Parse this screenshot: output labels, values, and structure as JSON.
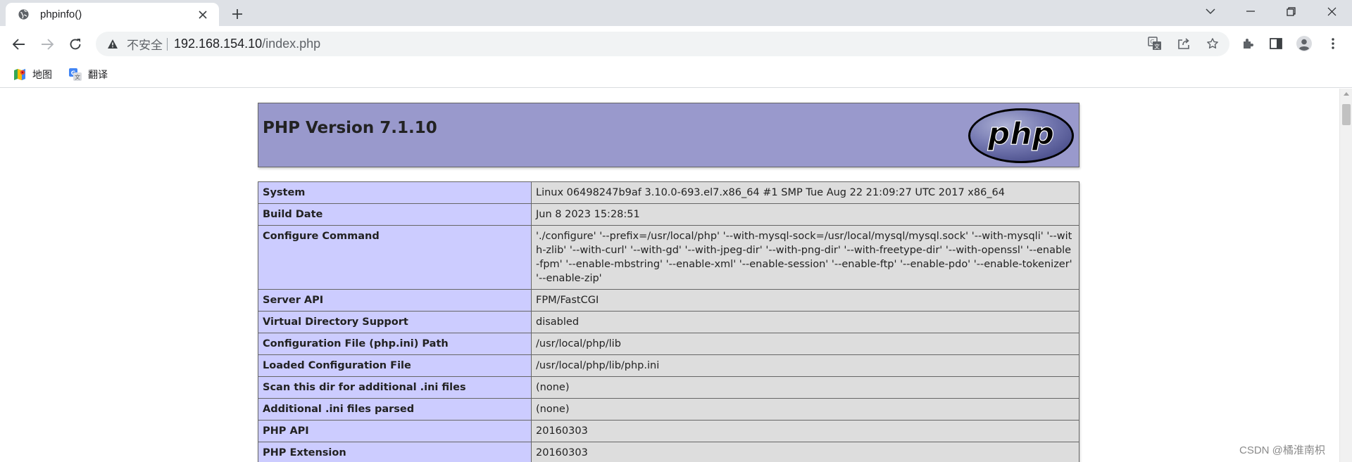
{
  "browser": {
    "tab": {
      "title": "phpinfo()"
    },
    "address": {
      "security_label": "不安全",
      "host": "192.168.154.10",
      "path": "/index.php"
    },
    "bookmarks": [
      {
        "label": "地图",
        "icon": "maps-icon"
      },
      {
        "label": "翻译",
        "icon": "translate-icon"
      }
    ]
  },
  "php": {
    "version_title": "PHP Version 7.1.10",
    "logo_text": "php",
    "rows": [
      {
        "key": "System",
        "value": "Linux 06498247b9af 3.10.0-693.el7.x86_64 #1 SMP Tue Aug 22 21:09:27 UTC 2017 x86_64"
      },
      {
        "key": "Build Date",
        "value": "Jun 8 2023 15:28:51"
      },
      {
        "key": "Configure Command",
        "value": "'./configure' '--prefix=/usr/local/php' '--with-mysql-sock=/usr/local/mysql/mysql.sock' '--with-mysqli' '--with-zlib' '--with-curl' '--with-gd' '--with-jpeg-dir' '--with-png-dir' '--with-freetype-dir' '--with-openssl' '--enable-fpm' '--enable-mbstring' '--enable-xml' '--enable-session' '--enable-ftp' '--enable-pdo' '--enable-tokenizer' '--enable-zip'"
      },
      {
        "key": "Server API",
        "value": "FPM/FastCGI"
      },
      {
        "key": "Virtual Directory Support",
        "value": "disabled"
      },
      {
        "key": "Configuration File (php.ini) Path",
        "value": "/usr/local/php/lib"
      },
      {
        "key": "Loaded Configuration File",
        "value": "/usr/local/php/lib/php.ini"
      },
      {
        "key": "Scan this dir for additional .ini files",
        "value": "(none)"
      },
      {
        "key": "Additional .ini files parsed",
        "value": "(none)"
      },
      {
        "key": "PHP API",
        "value": "20160303"
      },
      {
        "key": "PHP Extension",
        "value": "20160303"
      }
    ]
  },
  "watermark": "CSDN @橘淮南枳",
  "colors": {
    "header_bg": "#9999cc",
    "key_cell_bg": "#ccccff",
    "value_cell_bg": "#dddddd",
    "tabstrip_bg": "#dee1e6"
  }
}
